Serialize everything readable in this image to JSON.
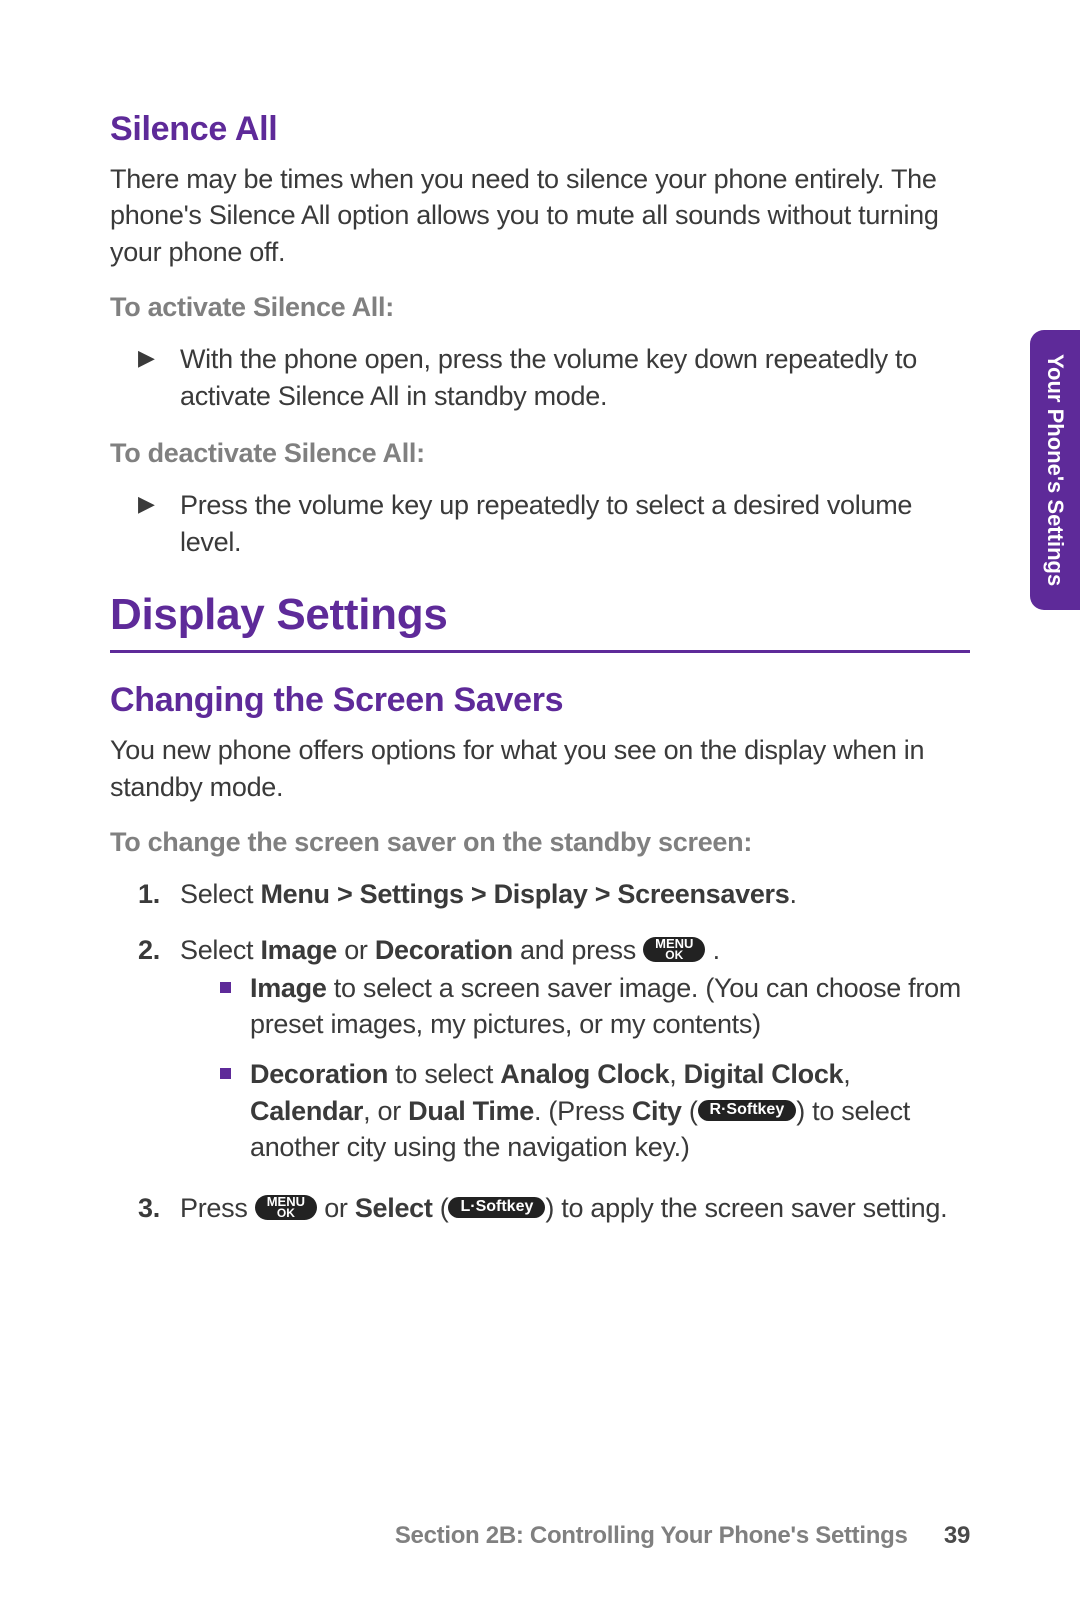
{
  "side_tab": "Your Phone's Settings",
  "silence_all": {
    "title": "Silence All",
    "intro": "There may be times when you need to silence your phone entirely. The phone's Silence All option allows you to mute all sounds without turning your phone off.",
    "activate_label": "To activate Silence All:",
    "activate_step": "With the phone open, press the volume key down repeatedly to activate Silence All in standby mode.",
    "deactivate_label": "To deactivate Silence All:",
    "deactivate_step": "Press the volume key up repeatedly to select a desired volume level."
  },
  "display": {
    "title": "Display Settings",
    "screen_savers": {
      "title": "Changing the Screen Savers",
      "intro": "You new phone offers options for what you see on the display when in standby mode.",
      "change_label": "To change the screen saver on the standby screen:",
      "step1_pre": "Select ",
      "step1_bold": "Menu > Settings > Display > Screensavers",
      "step1_post": ".",
      "step2_pre": "Select ",
      "step2_b1": "Image",
      "step2_mid": " or ",
      "step2_b2": "Decoration",
      "step2_after": " and press ",
      "step2_end": " .",
      "step2_image_b": "Image",
      "step2_image_rest": " to select a screen saver image. (You can choose from preset images, my pictures, or my contents)",
      "step2_dec_b1": "Decoration",
      "step2_dec_mid1": " to select ",
      "step2_dec_b2": "Analog Clock",
      "step2_dec_mid2": ", ",
      "step2_dec_b3": "Digital Clock",
      "step2_dec_mid3": ", ",
      "step2_dec_b4": "Calendar",
      "step2_dec_mid4": ", or ",
      "step2_dec_b5": "Dual Time",
      "step2_dec_mid5": ". (Press ",
      "step2_dec_b6": "City",
      "step2_dec_mid6": " (",
      "step2_dec_key": "R·Softkey",
      "step2_dec_end": ") to select another city using the navigation key.)",
      "step3_pre": "Press ",
      "step3_mid": " or ",
      "step3_bold": "Select",
      "step3_mid2": " (",
      "step3_key": "L·Softkey",
      "step3_end": ") to apply the screen saver setting."
    }
  },
  "keys": {
    "menu_top": "MENU",
    "menu_bot": "OK"
  },
  "footer": {
    "section": "Section 2B: Controlling Your Phone's Settings",
    "page": "39"
  }
}
